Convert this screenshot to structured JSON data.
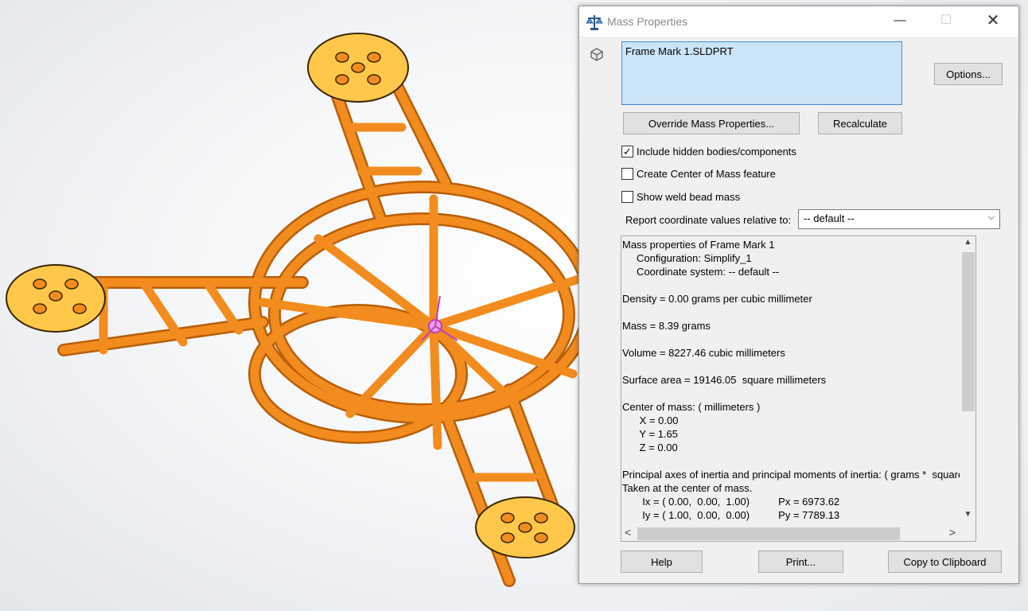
{
  "dialog": {
    "title": "Mass Properties",
    "minimize_glyph": "—",
    "maximize_glyph": "☐",
    "close_glyph": "✕",
    "selected_part": "Frame Mark 1.SLDPRT",
    "buttons": {
      "options": "Options...",
      "override": "Override Mass Properties...",
      "recalculate": "Recalculate",
      "help": "Help",
      "print": "Print...",
      "copy": "Copy to Clipboard"
    },
    "checkboxes": [
      {
        "label": "Include hidden bodies/components",
        "checked": true
      },
      {
        "label": "Create Center of Mass feature",
        "checked": false
      },
      {
        "label": "Show weld bead mass",
        "checked": false
      }
    ],
    "coord_label": "Report coordinate values relative to:",
    "coord_value": "-- default --"
  },
  "report": {
    "lines": [
      "Mass properties of Frame Mark 1",
      "     Configuration: Simplify_1",
      "     Coordinate system: -- default --",
      "",
      "Density = 0.00 grams per cubic millimeter",
      "",
      "Mass = 8.39 grams",
      "",
      "Volume = 8227.46 cubic millimeters",
      "",
      "Surface area = 19146.05  square millimeters",
      "",
      "Center of mass: ( millimeters )",
      "      X = 0.00",
      "      Y = 1.65",
      "      Z = 0.00",
      "",
      "Principal axes of inertia and principal moments of inertia: ( grams *  square millimeters )",
      "Taken at the center of mass.",
      "       Ix = ( 0.00,  0.00,  1.00)          Px = 6973.62",
      "       Iy = ( 1.00,  0.00,  0.00)          Py = 7789.13"
    ]
  },
  "icons": {
    "title": "scale-icon",
    "part": "part-icon",
    "scroll_up": "▲",
    "scroll_down": "▼",
    "scroll_left": "<",
    "scroll_right": ">",
    "dropdown": "⌵"
  },
  "colors": {
    "frame_orange": "#f28c1e",
    "pad_yellow": "#ffc84a",
    "selection_blue": "#cce4f7"
  }
}
